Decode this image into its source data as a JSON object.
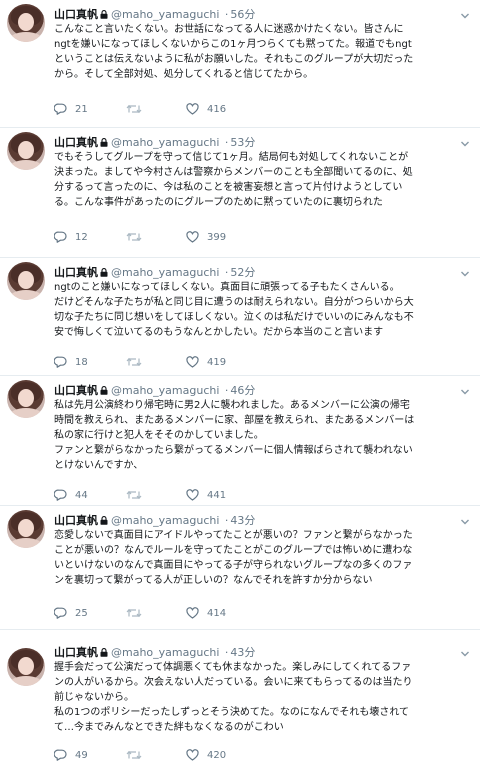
{
  "tweets": [
    {
      "name": "山口真帆",
      "handle": "@maho_yamaguchi",
      "separator": "·",
      "time": "56分",
      "text": "こんなこと言いたくない。お世話になってる人に迷惑かけたくない。皆さんに\nngtを嫌いになってほしくないからこの1ヶ月つらくても黙ってた。報道でもngt\nということは伝えないように私がお願いした。それもこのグループが大切だった\nから。そして全部対処、処分してくれると信じてたから。",
      "replies": "21",
      "retweets": "",
      "likes": "416"
    },
    {
      "name": "山口真帆",
      "handle": "@maho_yamaguchi",
      "separator": "·",
      "time": "53分",
      "text": "でもそうしてグループを守って信じて1ヶ月。結局何も対処してくれないことが\n決まった。ましてや今村さんは警察からメンバーのことも全部聞いてるのに、処\n分するって言ったのに、今は私のことを被害妄想と言って片付けようとしてい\nる。こんな事件があったのにグループのために黙っていたのに裏切られた",
      "replies": "12",
      "retweets": "",
      "likes": "399"
    },
    {
      "name": "山口真帆",
      "handle": "@maho_yamaguchi",
      "separator": "·",
      "time": "52分",
      "text": "ngtのこと嫌いになってほしくない。真面目に頑張ってる子もたくさんいる。\nだけどそんな子たちが私と同じ目に遭うのは耐えられない。自分がつらいから大\n切な子たちに同じ想いをしてほしくない。泣くのは私だけでいいのにみんなも不\n安で悔しくて泣いてるのもうなんとかしたい。だから本当のこと言います",
      "replies": "18",
      "retweets": "",
      "likes": "419"
    },
    {
      "name": "山口真帆",
      "handle": "@maho_yamaguchi",
      "separator": "·",
      "time": "46分",
      "text": "私は先月公演終わり帰宅時に男2人に襲われました。あるメンバーに公演の帰宅\n時間を教えられ、またあるメンバーに家、部屋を教えられ、またあるメンバーは\n私の家に行けと犯人をそそのかしていました。\nファンと繋がらなかったら繋がってるメンバーに個人情報ばらされて襲われない\nとけないんですか、",
      "replies": "44",
      "retweets": "",
      "likes": "441"
    },
    {
      "name": "山口真帆",
      "handle": "@maho_yamaguchi",
      "separator": "·",
      "time": "43分",
      "text": "恋愛しないで真面目にアイドルやってたことが悪いの？ファンと繋がらなかった\nことが悪いの？なんでルールを守ってたことがこのグループでは怖いめに遭わな\nいといけないのなんで真面目にやってる子が守られないグループなの多くのファ\nンを裏切って繋がってる人が正しいの？なんでそれを許すか分からない",
      "replies": "25",
      "retweets": "",
      "likes": "414"
    },
    {
      "name": "山口真帆",
      "handle": "@maho_yamaguchi",
      "separator": "·",
      "time": "43分",
      "text": "握手会だって公演だって体調悪くても休まなかった。楽しみにしてくれてるファ\nンの人がいるから。次会えない人だっている。会いに来てもらってるのは当たり\n前じゃないから。\n私の1つのポリシーだったしずっとそう決めてた。なのになんでそれも壊されて\nて…今までみんなとできた絆もなくなるのがこわい",
      "replies": "49",
      "retweets": "",
      "likes": "420"
    }
  ],
  "icons": {
    "lock": "lock-icon",
    "chevron": "chevron-down-icon",
    "reply": "reply-icon",
    "retweet": "retweet-icon",
    "like": "heart-icon"
  },
  "colors": {
    "text": "#14171a",
    "muted": "#657786",
    "divider": "#e6ecf0"
  }
}
